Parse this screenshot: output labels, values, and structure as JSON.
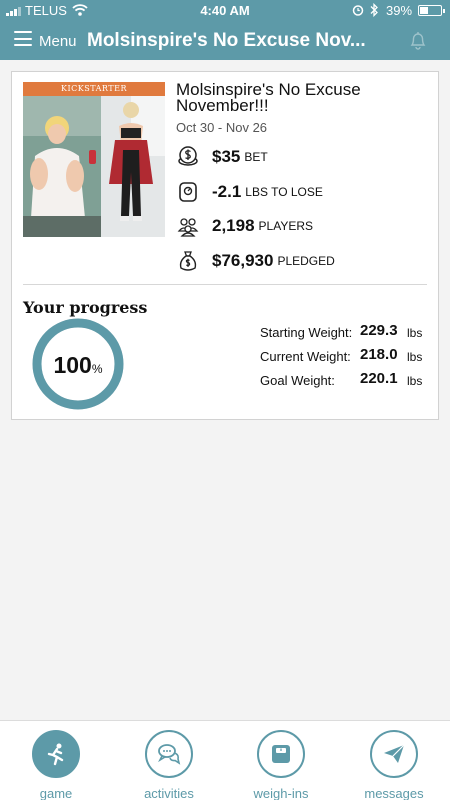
{
  "status_bar": {
    "carrier": "TELUS",
    "time": "4:40 AM",
    "battery_percent": "39%",
    "battery_level": 0.39
  },
  "nav": {
    "menu_label": "Menu",
    "title": "Molsinspire's No Excuse Nov..."
  },
  "challenge": {
    "banner": "KICKSTARTER",
    "title": "Molsinspire's No Excuse November!!!",
    "dates": "Oct 30 - Nov 26",
    "stats": [
      {
        "icon": "bet-coin-icon",
        "value": "$35",
        "unit": "BET"
      },
      {
        "icon": "scale-icon",
        "value": "-2.1",
        "unit": "LBS TO LOSE"
      },
      {
        "icon": "players-icon",
        "value": "2,198",
        "unit": "PLAYERS"
      },
      {
        "icon": "money-bag-icon",
        "value": "$76,930",
        "unit": "PLEDGED"
      }
    ]
  },
  "progress": {
    "title": "Your progress",
    "percent": "100",
    "percent_symbol": "%",
    "ring_fraction": 1.0,
    "weights": [
      {
        "label": "Starting Weight:",
        "value": "229.3",
        "unit": "lbs"
      },
      {
        "label": "Current Weight:",
        "value": "218.0",
        "unit": "lbs"
      },
      {
        "label": "Goal Weight:",
        "value": "220.1",
        "unit": "lbs"
      }
    ]
  },
  "tabs": [
    {
      "label": "game",
      "icon": "runner-icon",
      "active": true
    },
    {
      "label": "activities",
      "icon": "chat-bubbles-icon",
      "active": false
    },
    {
      "label": "weigh-ins",
      "icon": "scale-icon",
      "active": false
    },
    {
      "label": "messages",
      "icon": "paper-plane-icon",
      "active": false
    }
  ],
  "colors": {
    "accent": "#5d9aa8",
    "banner": "#e07a3e",
    "background": "#f3f3f3"
  }
}
